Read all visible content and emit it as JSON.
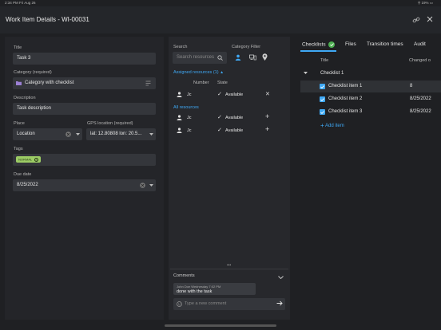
{
  "status_bar": {
    "left": "2:34 PM   Fri Aug 26",
    "right": "⚲ 19% ▭"
  },
  "header": {
    "title": "Work Item Details - WI-00031"
  },
  "left": {
    "title_label": "Title",
    "title_value": "Task 3",
    "category_label": "Category (required)",
    "category_value": "Category with checklist",
    "description_label": "Description",
    "description_value": "Task description",
    "place_label": "Place",
    "place_value": "Location",
    "gps_label": "GPS location (required)",
    "gps_value": "lat: 12.80808 lon: 20.5...",
    "tags_label": "Tags",
    "tag": "NORMAL",
    "due_label": "Due date",
    "due_value": "8/25/2022"
  },
  "middle": {
    "search_label": "Search",
    "search_placeholder": "Search resources",
    "category_filter_label": "Category Filter",
    "assigned_label": "Assigned resources (1)",
    "col_number": "Number",
    "col_state": "State",
    "assigned_rows": [
      {
        "name": "Jc",
        "state": "Available"
      }
    ],
    "all_label": "All resources",
    "all_rows": [
      {
        "name": "Jc",
        "state": "Available"
      },
      {
        "name": "Jc",
        "state": "Available"
      }
    ],
    "more": "•••",
    "comments_label": "Comments",
    "comment_meta": "John Doe    Wednesday   7:02 PM",
    "comment_text": "done with the task",
    "comment_placeholder": "Type a new comment"
  },
  "right": {
    "tabs": [
      "Checklists",
      "Files",
      "Transition times",
      "Audit"
    ],
    "col_title": "Title",
    "col_changed": "Changed o",
    "group": "Checklist 1",
    "items": [
      {
        "title": "Checklist item 1",
        "changed": "8"
      },
      {
        "title": "Checklist item 2",
        "changed": "8/25/2022"
      },
      {
        "title": "Checklist item 3",
        "changed": "8/25/2022"
      }
    ],
    "add_item": "Add item"
  },
  "colors": {
    "accent": "#3fa9f5",
    "tag": "#9ccc65",
    "success": "#4caf50"
  }
}
